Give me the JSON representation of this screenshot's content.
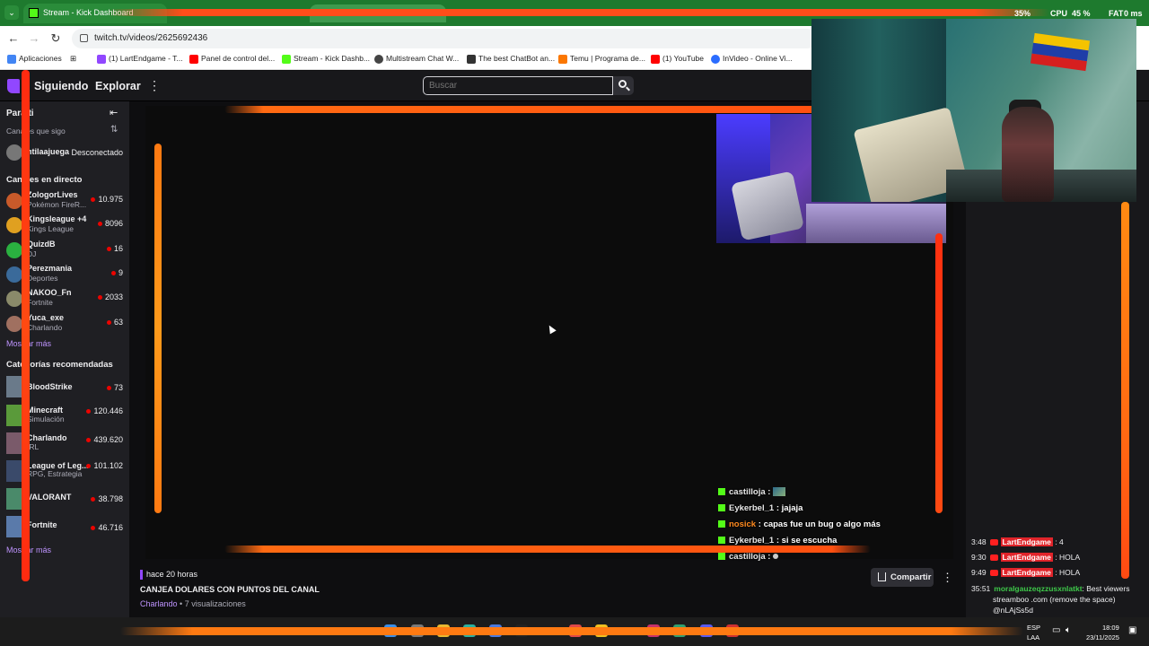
{
  "browser": {
    "active_tab_title": "Stream - Kick Dashboard",
    "url": "twitch.tv/videos/2625692436",
    "system_stats": {
      "cpu_label": "CPU",
      "cpu_value": "45 %",
      "stat_pct": "35%",
      "fat_label": "FAT",
      "fat_value": "0 ms"
    }
  },
  "bookmarks": [
    {
      "label": "Aplicaciones",
      "color": "#4285f4"
    },
    {
      "label": "(1) LartEndgame - T...",
      "color": "#9147ff"
    },
    {
      "label": "Panel de control del...",
      "color": "#ff0000"
    },
    {
      "label": "Stream - Kick Dashb...",
      "color": "#53fc18"
    },
    {
      "label": "Multistream Chat W...",
      "color": "#444444"
    },
    {
      "label": "The best ChatBot an...",
      "color": "#333333"
    },
    {
      "label": "Temu | Programa de...",
      "color": "#fb7701"
    },
    {
      "label": "(1) YouTube",
      "color": "#ff0000"
    },
    {
      "label": "InVideo - Online Vi...",
      "color": "#2b6cff"
    }
  ],
  "twitch_nav": {
    "following": "Siguiendo",
    "browse": "Explorar",
    "more": "⋮",
    "search_placeholder": "Buscar"
  },
  "sidebar": {
    "for_you": "Para ti",
    "followed_heading": "Canales que sigo",
    "followed": [
      {
        "name": "ntilaajuega",
        "status": "Desconectado"
      }
    ],
    "live_heading": "Canales en directo",
    "live": [
      {
        "name": "ZologorLives",
        "category": "Pokémon FireR...",
        "viewers": "10.975",
        "color": "#c85a2a"
      },
      {
        "name": "Kingsleague +4",
        "category": "Kings League",
        "viewers": "8096",
        "color": "#e0a020"
      },
      {
        "name": "QuizdB",
        "category": "DJ",
        "viewers": "16",
        "color": "#2ab040"
      },
      {
        "name": "Perezmania",
        "category": "Deportes",
        "viewers": "9",
        "color": "#3a6a9a"
      },
      {
        "name": "NAKOO_Fn",
        "category": "Fortnite",
        "viewers": "2033",
        "color": "#8a8a6a"
      },
      {
        "name": "Yuca_exe",
        "category": "Charlando",
        "viewers": "63",
        "color": "#a07060"
      }
    ],
    "show_more": "Mostrar más",
    "recommended_heading": "Categorías recomendadas",
    "categories": [
      {
        "name": "BloodStrike",
        "sub": "",
        "viewers": "73",
        "color": "#6a7a8a"
      },
      {
        "name": "Minecraft",
        "sub": "Simulación",
        "viewers": "120.446",
        "color": "#5a9a3a"
      },
      {
        "name": "Charlando",
        "sub": "IRL",
        "viewers": "439.620",
        "color": "#7a5a6a"
      },
      {
        "name": "League of Leg...",
        "sub": "RPG, Estrategia",
        "viewers": "101.102",
        "color": "#3a4a6a"
      },
      {
        "name": "VALORANT",
        "sub": "",
        "viewers": "38.798",
        "color": "#4a8a6a"
      },
      {
        "name": "Fortnite",
        "sub": "",
        "viewers": "46.716",
        "color": "#5a7aaa"
      }
    ],
    "show_more_2": "Mostrar más"
  },
  "overlay_chat": [
    {
      "user": "castilloja",
      "msg": "",
      "emote": true,
      "user_color": "default"
    },
    {
      "user": "Eykerbel_1",
      "msg": "jajaja",
      "emote": false,
      "user_color": "default"
    },
    {
      "user": "nosick",
      "msg": "capas fue un bug o algo más",
      "emote": false,
      "user_color": "orange"
    },
    {
      "user": "Eykerbel_1",
      "msg": "si se escucha",
      "emote": false,
      "user_color": "default"
    },
    {
      "user": "castilloja",
      "msg": "",
      "emote": true,
      "user_color": "default"
    }
  ],
  "video_info": {
    "time_ago": "hace 20 horas",
    "title": "CANJEA DOLARES CON PUNTOS DEL CANAL",
    "category": "Charlando",
    "views": "7 visualizaciones",
    "share": "Compartir",
    "more": "⋮"
  },
  "right_chat": [
    {
      "time": "3:48",
      "user": "LartEndgame",
      "msg": "4"
    },
    {
      "time": "9:30",
      "user": "LartEndgame",
      "msg": "HOLA"
    },
    {
      "time": "9:49",
      "user": "LartEndgame",
      "msg": "HOLA"
    }
  ],
  "right_chat_last": {
    "time": "35:51",
    "user": "moralgauzeqzzusxnlatkt",
    "line1": "Best viewers",
    "line2": "streamboo .com (remove the space)",
    "line3": "@nLAjSs5d"
  },
  "taskbar": {
    "lang": "ESP",
    "lang_sub": "LAA",
    "time": "18:09",
    "date": "23/11/2025"
  },
  "colors": {
    "twitch_purple": "#9147ff",
    "kick_green": "#53fc18",
    "overlay_orange": "#ff6a12"
  }
}
